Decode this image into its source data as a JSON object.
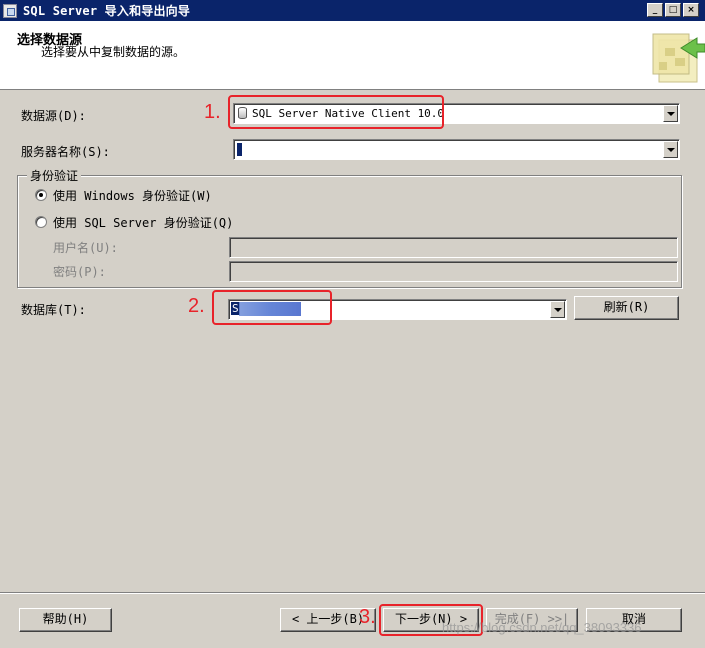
{
  "window": {
    "title": "SQL Server 导入和导出向导",
    "controls": [
      "_",
      "□",
      "×"
    ]
  },
  "header": {
    "title": "选择数据源",
    "subtitle": "选择要从中复制数据的源。"
  },
  "form": {
    "datasource_label": "数据源(D):",
    "datasource_value": "SQL Server Native Client 10.0",
    "server_label": "服务器名称(S):",
    "server_value": "",
    "auth_group_label": "身份验证",
    "windows_auth_label": "使用 Windows 身份验证(W)",
    "sql_auth_label": "使用 SQL Server 身份验证(Q)",
    "auth_selected": "windows",
    "username_label": "用户名(U):",
    "password_label": "密码(P):",
    "database_label": "数据库(T):",
    "database_value": "S",
    "refresh_label": "刷新(R)"
  },
  "footer": {
    "help_label": "帮助(H)",
    "back_label": "< 上一步(B)",
    "next_label": "下一步(N) >",
    "finish_label": "完成(F) >>|",
    "cancel_label": "取消"
  },
  "annotations": {
    "step1": "1.",
    "step2": "2.",
    "step3": "3.",
    "color": "#e8232a"
  },
  "watermark": "https://blog.csdn.net/qq_38093336"
}
